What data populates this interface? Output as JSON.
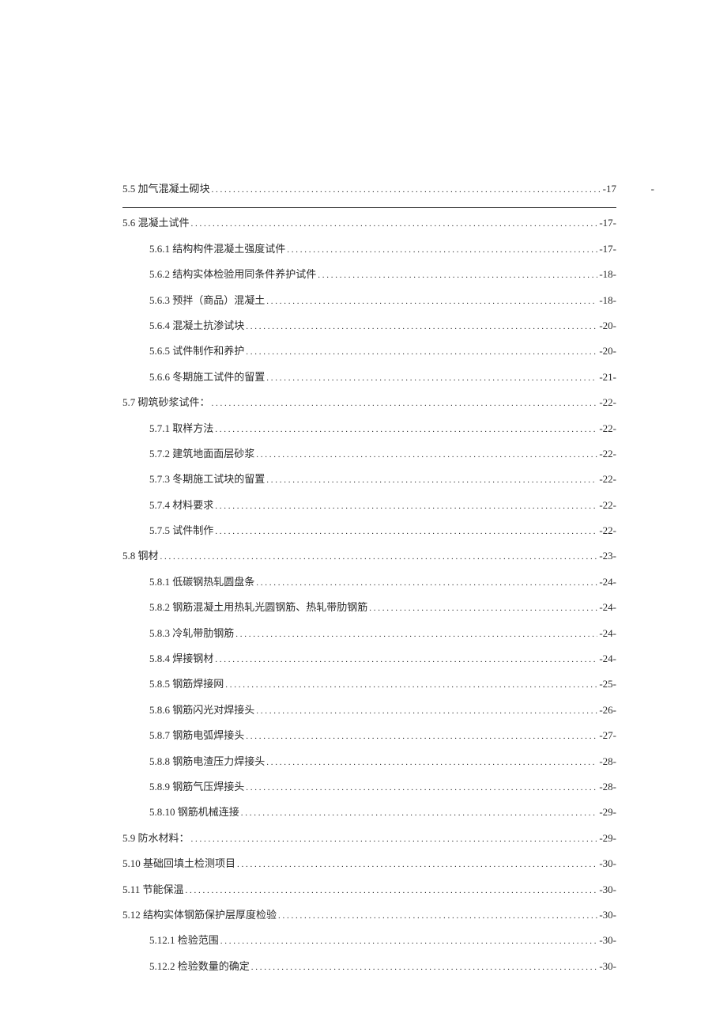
{
  "toc": [
    {
      "level": 1,
      "num": "5.5",
      "title": "加气混凝土砌块",
      "page": "-17",
      "first_special": true
    },
    {
      "level": 1,
      "num": "5.6",
      "title": "混凝土试件",
      "page": "-17-"
    },
    {
      "level": 2,
      "num": "5.6.1",
      "title": "结构构件混凝土强度试件",
      "page": "-17-"
    },
    {
      "level": 2,
      "num": "5.6.2",
      "title": "结构实体检验用同条件养护试件",
      "page": "-18-"
    },
    {
      "level": 2,
      "num": "5.6.3",
      "title": "预拌（商品）混凝土",
      "page": "-18-"
    },
    {
      "level": 2,
      "num": "5.6.4",
      "title": "混凝土抗渗试块",
      "page": "-20-"
    },
    {
      "level": 2,
      "num": "5.6.5",
      "title": "试件制作和养护",
      "page": "-20-"
    },
    {
      "level": 2,
      "num": "5.6.6",
      "title": "冬期施工试件的留置",
      "page": "-21-"
    },
    {
      "level": 1,
      "num": "5.7",
      "title": "砌筑砂浆试件：",
      "page": "-22-"
    },
    {
      "level": 2,
      "num": "5.7.1",
      "title": "取样方法",
      "page": "-22-"
    },
    {
      "level": 2,
      "num": "5.7.2",
      "title": "建筑地面面层砂浆",
      "page": "-22-"
    },
    {
      "level": 2,
      "num": "5.7.3",
      "title": "冬期施工试块的留置",
      "page": "-22-"
    },
    {
      "level": 2,
      "num": "5.7.4",
      "title": "材料要求",
      "page": "-22-"
    },
    {
      "level": 2,
      "num": "5.7.5",
      "title": "试件制作",
      "page": "-22-"
    },
    {
      "level": 1,
      "num": "5.8",
      "title": "钢材",
      "page": "-23-"
    },
    {
      "level": 2,
      "num": "5.8.1",
      "title": "低碳钢热轧圆盘条",
      "page": "-24-"
    },
    {
      "level": 2,
      "num": "5.8.2",
      "title": "钢筋混凝土用热轧光圆钢筋、热轧带肋钢筋",
      "page": "-24-"
    },
    {
      "level": 2,
      "num": "5.8.3",
      "title": "冷轧带肋钢筋",
      "page": "-24-"
    },
    {
      "level": 2,
      "num": "5.8.4",
      "title": "焊接钢材",
      "page": "-24-"
    },
    {
      "level": 2,
      "num": "5.8.5",
      "title": "钢筋焊接网",
      "page": "-25-"
    },
    {
      "level": 2,
      "num": "5.8.6",
      "title": "钢筋闪光对焊接头",
      "page": "-26-"
    },
    {
      "level": 2,
      "num": "5.8.7",
      "title": "钢筋电弧焊接头",
      "page": "-27-"
    },
    {
      "level": 2,
      "num": "5.8.8",
      "title": "钢筋电渣压力焊接头",
      "page": "-28-"
    },
    {
      "level": 2,
      "num": "5.8.9",
      "title": "钢筋气压焊接头",
      "page": "-28-"
    },
    {
      "level": 2,
      "num": "5.8.10",
      "title": "钢筋机械连接",
      "page": "-29-"
    },
    {
      "level": 1,
      "num": "5.9",
      "title": "防水材料：",
      "page": "-29-"
    },
    {
      "level": 1,
      "num": "5.10",
      "title": "基础回填土检测项目",
      "page": "-30-"
    },
    {
      "level": 1,
      "num": "5.11",
      "title": "节能保温",
      "page": "-30-"
    },
    {
      "level": 1,
      "num": "5.12",
      "title": "结构实体钢筋保护层厚度检验",
      "page": "-30-"
    },
    {
      "level": 2,
      "num": "5.12.1",
      "title": "检验范围",
      "page": "-30-"
    },
    {
      "level": 2,
      "num": "5.12.2",
      "title": "检验数量的确定",
      "page": "-30-"
    }
  ],
  "trail_dash": "-"
}
